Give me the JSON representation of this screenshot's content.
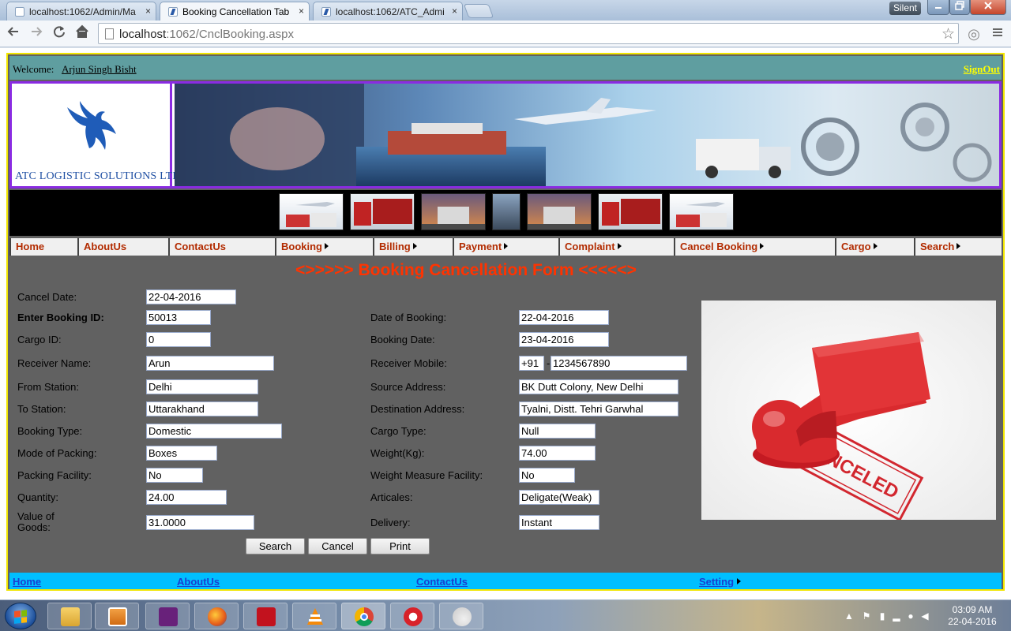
{
  "browser": {
    "tabs": [
      {
        "title": "localhost:1062/Admin/Ma",
        "active": false
      },
      {
        "title": "Booking Cancellation Tab",
        "active": true
      },
      {
        "title": "localhost:1062/ATC_Admi",
        "active": false
      }
    ],
    "silent_badge": "Silent",
    "url_host": "localhost",
    "url_rest": ":1062/CnclBooking.aspx",
    "close_glyph": "×"
  },
  "header": {
    "welcome_label": "Welcome:",
    "user_name": "Arjun Singh Bisht",
    "signout": "SignOut",
    "company_name": "ATC LOGISTIC SOLUTIONS LTD."
  },
  "menu": {
    "items": [
      {
        "label": "Home",
        "has_submenu": false
      },
      {
        "label": "AboutUs",
        "has_submenu": false
      },
      {
        "label": "ContactUs",
        "has_submenu": false
      },
      {
        "label": "Booking",
        "has_submenu": true
      },
      {
        "label": "Billing",
        "has_submenu": true
      },
      {
        "label": "Payment",
        "has_submenu": true
      },
      {
        "label": "Complaint",
        "has_submenu": true
      },
      {
        "label": "Cancel Booking",
        "has_submenu": true
      },
      {
        "label": "Cargo",
        "has_submenu": true
      },
      {
        "label": "Search",
        "has_submenu": true
      }
    ]
  },
  "form": {
    "title": "<>>>>> Booking Cancellation Form <<<<<>",
    "cancel_date": {
      "label": "Cancel Date:",
      "value": "22-04-2016"
    },
    "booking_id": {
      "label": "Enter Booking ID:",
      "value": "50013"
    },
    "cargo_id": {
      "label": "Cargo ID:",
      "value": "0"
    },
    "receiver_name": {
      "label": "Receiver Name:",
      "value": "Arun"
    },
    "from_station": {
      "label": "From Station:",
      "value": "Delhi"
    },
    "to_station": {
      "label": "To Station:",
      "value": "Uttarakhand"
    },
    "booking_type": {
      "label": "Booking Type:",
      "value": "Domestic"
    },
    "mode_of_packing": {
      "label": "Mode of Packing:",
      "value": "Boxes"
    },
    "packing_facility": {
      "label": "Packing Facility:",
      "value": "No"
    },
    "quantity": {
      "label": "Quantity:",
      "value": "24.00"
    },
    "value_of_goods": {
      "label_line1": "Value of",
      "label_line2": "Goods:",
      "value": "31.0000"
    },
    "date_of_booking": {
      "label": "Date of Booking:",
      "value": "22-04-2016"
    },
    "booking_date": {
      "label": "Booking Date:",
      "value": "23-04-2016"
    },
    "receiver_mobile": {
      "label": "Receiver Mobile:",
      "code": "+91",
      "separator": "-",
      "value": "1234567890"
    },
    "source_address": {
      "label": "Source Address:",
      "value": "BK Dutt Colony, New Delhi"
    },
    "destination_address": {
      "label": "Destination Address:",
      "value": "Tyalni, Distt. Tehri Garwhal"
    },
    "cargo_type": {
      "label": "Cargo Type:",
      "value": "Null"
    },
    "weight": {
      "label": "Weight(Kg):",
      "value": "74.00"
    },
    "weight_measure_facility": {
      "label": "Weight Measure Facility:",
      "value": "No"
    },
    "articales": {
      "label": "Articales:",
      "value": "Deligate(Weak)"
    },
    "delivery": {
      "label": "Delivery:",
      "value": "Instant"
    },
    "buttons": {
      "search": "Search",
      "cancel": "Cancel",
      "print": "Print"
    },
    "stamp_text": "CANCELED"
  },
  "footer": {
    "home": "Home",
    "about": "AboutUs",
    "contact": "ContactUs",
    "setting": "Setting"
  },
  "taskbar": {
    "time": "03:09 AM",
    "date": "22-04-2016"
  }
}
